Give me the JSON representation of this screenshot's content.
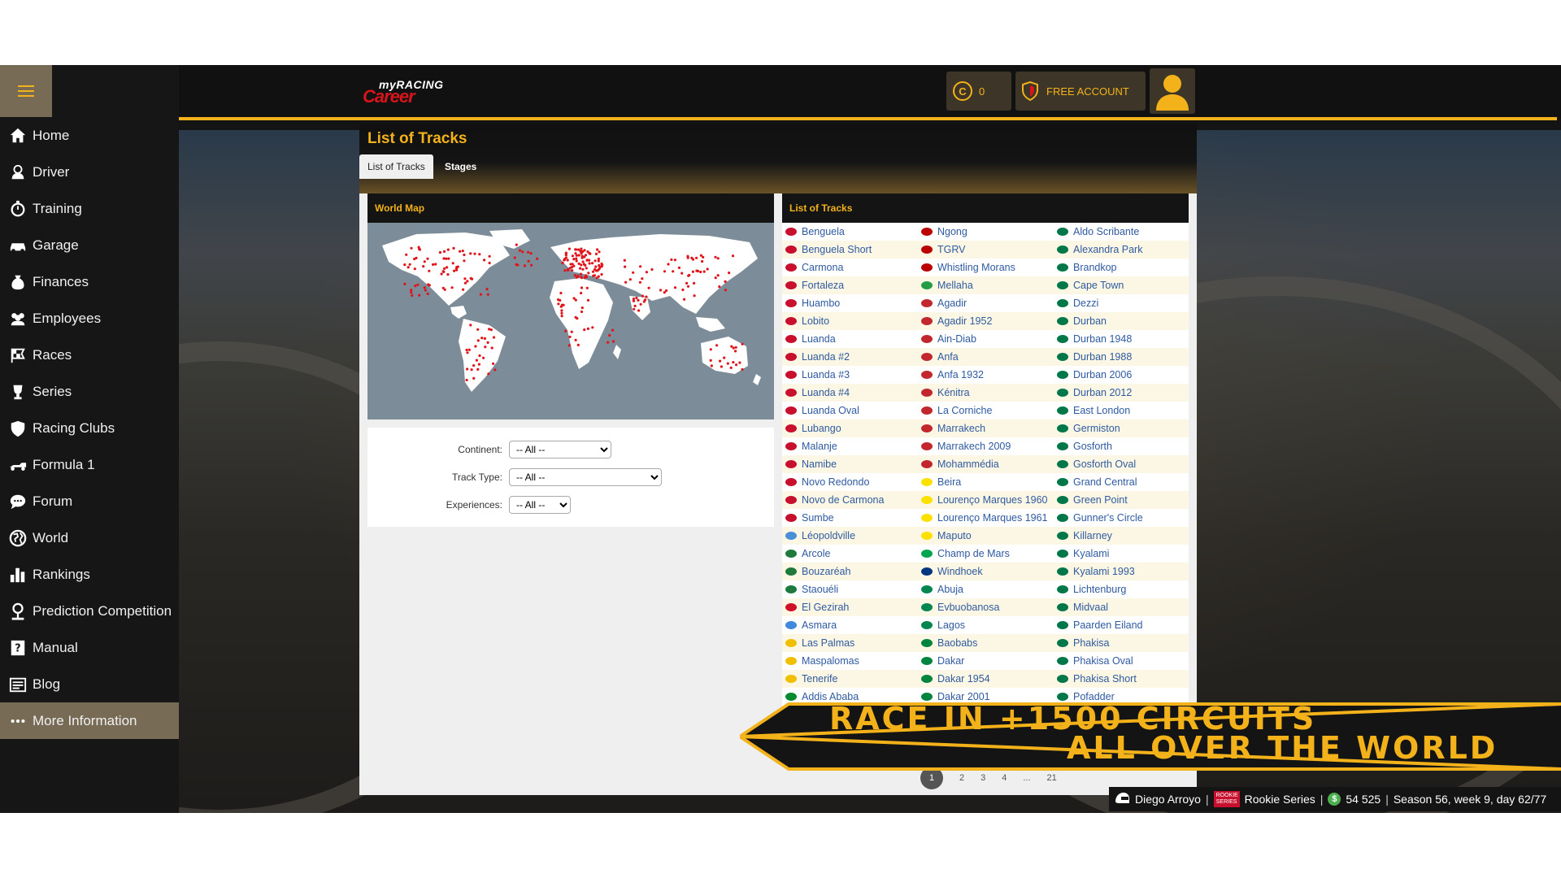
{
  "sidebar": {
    "items": [
      {
        "label": "Home",
        "icon": "home-icon"
      },
      {
        "label": "Driver",
        "icon": "driver-icon"
      },
      {
        "label": "Training",
        "icon": "stopwatch-icon"
      },
      {
        "label": "Garage",
        "icon": "car-icon"
      },
      {
        "label": "Finances",
        "icon": "money-bag-icon"
      },
      {
        "label": "Employees",
        "icon": "people-icon"
      },
      {
        "label": "Races",
        "icon": "checkered-flag-icon"
      },
      {
        "label": "Series",
        "icon": "trophy-icon"
      },
      {
        "label": "Racing Clubs",
        "icon": "shield-icon"
      },
      {
        "label": "Formula 1",
        "icon": "f1-car-icon"
      },
      {
        "label": "Forum",
        "icon": "chat-icon"
      },
      {
        "label": "World",
        "icon": "globe-icon"
      },
      {
        "label": "Rankings",
        "icon": "bar-chart-icon"
      },
      {
        "label": "Prediction Competition",
        "icon": "person-icon"
      },
      {
        "label": "Manual",
        "icon": "question-book-icon"
      },
      {
        "label": "Blog",
        "icon": "newspaper-icon"
      },
      {
        "label": "More Information",
        "icon": "ellipsis-icon"
      }
    ],
    "active_index": 16
  },
  "header": {
    "logo_top": "myRACING",
    "logo_bottom": "Career",
    "coins": "0",
    "account": "FREE ACCOUNT"
  },
  "page": {
    "title": "List of Tracks",
    "tabs": [
      "List of Tracks",
      "Stages"
    ],
    "map_title": "World Map",
    "list_title": "List of Tracks"
  },
  "filters": {
    "continent": {
      "label": "Continent:",
      "value": "-- All --"
    },
    "track_type": {
      "label": "Track Type:",
      "value": "-- All --"
    },
    "experiences": {
      "label": "Experiences:",
      "value": "-- All --"
    }
  },
  "tracks": {
    "columns": [
      [
        {
          "name": "Benguela",
          "flag": "#c8102e"
        },
        {
          "name": "Benguela Short",
          "flag": "#c8102e"
        },
        {
          "name": "Carmona",
          "flag": "#c8102e"
        },
        {
          "name": "Fortaleza",
          "flag": "#c8102e"
        },
        {
          "name": "Huambo",
          "flag": "#c8102e"
        },
        {
          "name": "Lobito",
          "flag": "#c8102e"
        },
        {
          "name": "Luanda",
          "flag": "#c8102e"
        },
        {
          "name": "Luanda #2",
          "flag": "#c8102e"
        },
        {
          "name": "Luanda #3",
          "flag": "#c8102e"
        },
        {
          "name": "Luanda #4",
          "flag": "#c8102e"
        },
        {
          "name": "Luanda Oval",
          "flag": "#c8102e"
        },
        {
          "name": "Lubango",
          "flag": "#c8102e"
        },
        {
          "name": "Malanje",
          "flag": "#c8102e"
        },
        {
          "name": "Namibe",
          "flag": "#c8102e"
        },
        {
          "name": "Novo Redondo",
          "flag": "#c8102e"
        },
        {
          "name": "Novo de Carmona",
          "flag": "#c8102e"
        },
        {
          "name": "Sumbe",
          "flag": "#c8102e"
        },
        {
          "name": "Léopoldville",
          "flag": "#4a90d9"
        },
        {
          "name": "Arcole",
          "flag": "#1e7a3c"
        },
        {
          "name": "Bouzaréah",
          "flag": "#1e7a3c"
        },
        {
          "name": "Staouéli",
          "flag": "#1e7a3c"
        },
        {
          "name": "El Gezirah",
          "flag": "#ce1126"
        },
        {
          "name": "Asmara",
          "flag": "#4189dd"
        },
        {
          "name": "Las Palmas",
          "flag": "#f1bf00"
        },
        {
          "name": "Maspalomas",
          "flag": "#f1bf00"
        },
        {
          "name": "Tenerife",
          "flag": "#f1bf00"
        },
        {
          "name": "Addis Ababa",
          "flag": "#078930"
        }
      ],
      [
        {
          "name": "Ngong",
          "flag": "#bb0000"
        },
        {
          "name": "TGRV",
          "flag": "#bb0000"
        },
        {
          "name": "Whistling Morans",
          "flag": "#bb0000"
        },
        {
          "name": "Mellaha",
          "flag": "#239e46"
        },
        {
          "name": "Agadir",
          "flag": "#c1272d"
        },
        {
          "name": "Agadir 1952",
          "flag": "#c1272d"
        },
        {
          "name": "Ain-Diab",
          "flag": "#c1272d"
        },
        {
          "name": "Anfa",
          "flag": "#c1272d"
        },
        {
          "name": "Anfa 1932",
          "flag": "#c1272d"
        },
        {
          "name": "Kénitra",
          "flag": "#c1272d"
        },
        {
          "name": "La Corniche",
          "flag": "#c1272d"
        },
        {
          "name": "Marrakech",
          "flag": "#c1272d"
        },
        {
          "name": "Marrakech 2009",
          "flag": "#c1272d"
        },
        {
          "name": "Mohammédia",
          "flag": "#c1272d"
        },
        {
          "name": "Beira",
          "flag": "#fce100"
        },
        {
          "name": "Lourenço Marques 1960",
          "flag": "#fce100"
        },
        {
          "name": "Lourenço Marques 1961",
          "flag": "#fce100"
        },
        {
          "name": "Maputo",
          "flag": "#fce100"
        },
        {
          "name": "Champ de Mars",
          "flag": "#00a551"
        },
        {
          "name": "Windhoek",
          "flag": "#003580"
        },
        {
          "name": "Abuja",
          "flag": "#008751"
        },
        {
          "name": "Evbuobanosa",
          "flag": "#008751"
        },
        {
          "name": "Lagos",
          "flag": "#008751"
        },
        {
          "name": "Baobabs",
          "flag": "#00853f"
        },
        {
          "name": "Dakar",
          "flag": "#00853f"
        },
        {
          "name": "Dakar 1954",
          "flag": "#00853f"
        },
        {
          "name": "Dakar 2001",
          "flag": "#00853f"
        }
      ],
      [
        {
          "name": "Aldo Scribante",
          "flag": "#007749"
        },
        {
          "name": "Alexandra Park",
          "flag": "#007749"
        },
        {
          "name": "Brandkop",
          "flag": "#007749"
        },
        {
          "name": "Cape Town",
          "flag": "#007749"
        },
        {
          "name": "Dezzi",
          "flag": "#007749"
        },
        {
          "name": "Durban",
          "flag": "#007749"
        },
        {
          "name": "Durban 1948",
          "flag": "#007749"
        },
        {
          "name": "Durban 1988",
          "flag": "#007749"
        },
        {
          "name": "Durban 2006",
          "flag": "#007749"
        },
        {
          "name": "Durban 2012",
          "flag": "#007749"
        },
        {
          "name": "East London",
          "flag": "#007749"
        },
        {
          "name": "Germiston",
          "flag": "#007749"
        },
        {
          "name": "Gosforth",
          "flag": "#007749"
        },
        {
          "name": "Gosforth Oval",
          "flag": "#007749"
        },
        {
          "name": "Grand Central",
          "flag": "#007749"
        },
        {
          "name": "Green Point",
          "flag": "#007749"
        },
        {
          "name": "Gunner's Circle",
          "flag": "#007749"
        },
        {
          "name": "Killarney",
          "flag": "#007749"
        },
        {
          "name": "Kyalami",
          "flag": "#007749"
        },
        {
          "name": "Kyalami 1993",
          "flag": "#007749"
        },
        {
          "name": "Lichtenburg",
          "flag": "#007749"
        },
        {
          "name": "Midvaal",
          "flag": "#007749"
        },
        {
          "name": "Paarden Eiland",
          "flag": "#007749"
        },
        {
          "name": "Phakisa",
          "flag": "#007749"
        },
        {
          "name": "Phakisa Oval",
          "flag": "#007749"
        },
        {
          "name": "Phakisa Short",
          "flag": "#007749"
        },
        {
          "name": "Pofadder",
          "flag": "#007749"
        }
      ]
    ]
  },
  "pagination": {
    "pages": [
      "1",
      "2",
      "3",
      "4",
      "...",
      "21"
    ],
    "current": "1"
  },
  "banner": {
    "line1": "RACE IN +1500 CIRCUITS",
    "line2": "ALL OVER THE WORLD"
  },
  "status": {
    "driver": "Diego Arroyo",
    "series_badge": "ROOKIE SERIES",
    "series": "Rookie Series",
    "money": "54 525",
    "season": "Season 56, week 9, day 62/77"
  },
  "colors": {
    "accent": "#f3b21a",
    "link": "#2f5aa0",
    "active_nav": "#776b56"
  }
}
